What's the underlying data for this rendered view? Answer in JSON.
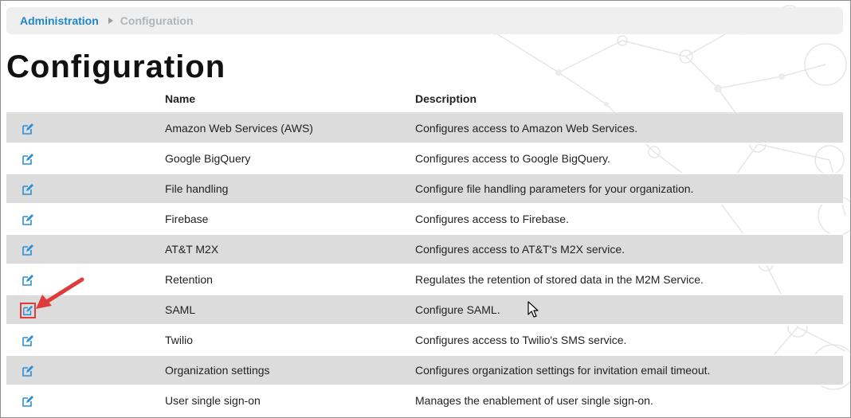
{
  "breadcrumb": {
    "parent": "Administration",
    "current": "Configuration"
  },
  "page_title": "Configuration",
  "table": {
    "columns": {
      "name": "Name",
      "description": "Description"
    },
    "rows": [
      {
        "name": "Amazon Web Services (AWS)",
        "description": "Configures access to Amazon Web Services."
      },
      {
        "name": "Google BigQuery",
        "description": "Configures access to Google BigQuery."
      },
      {
        "name": "File handling",
        "description": "Configure file handling parameters for your organization."
      },
      {
        "name": "Firebase",
        "description": "Configures access to Firebase."
      },
      {
        "name": "AT&T M2X",
        "description": "Configures access to AT&T's M2X service."
      },
      {
        "name": "Retention",
        "description": "Regulates the retention of stored data in the M2M Service."
      },
      {
        "name": "SAML",
        "description": "Configure SAML."
      },
      {
        "name": "Twilio",
        "description": "Configures access to Twilio's SMS service."
      },
      {
        "name": "Organization settings",
        "description": "Configures organization settings for invitation email timeout."
      },
      {
        "name": "User single sign-on",
        "description": "Manages the enablement of user single sign-on."
      }
    ]
  },
  "colors": {
    "link": "#1f86c8",
    "row_shade": "#dcdcdc",
    "highlight": "#e03b3b",
    "edit_icon": "#2a8fd6"
  },
  "icons": {
    "edit": "edit-icon",
    "annotation": "red-arrow-icon",
    "cursor": "mouse-cursor-icon"
  }
}
